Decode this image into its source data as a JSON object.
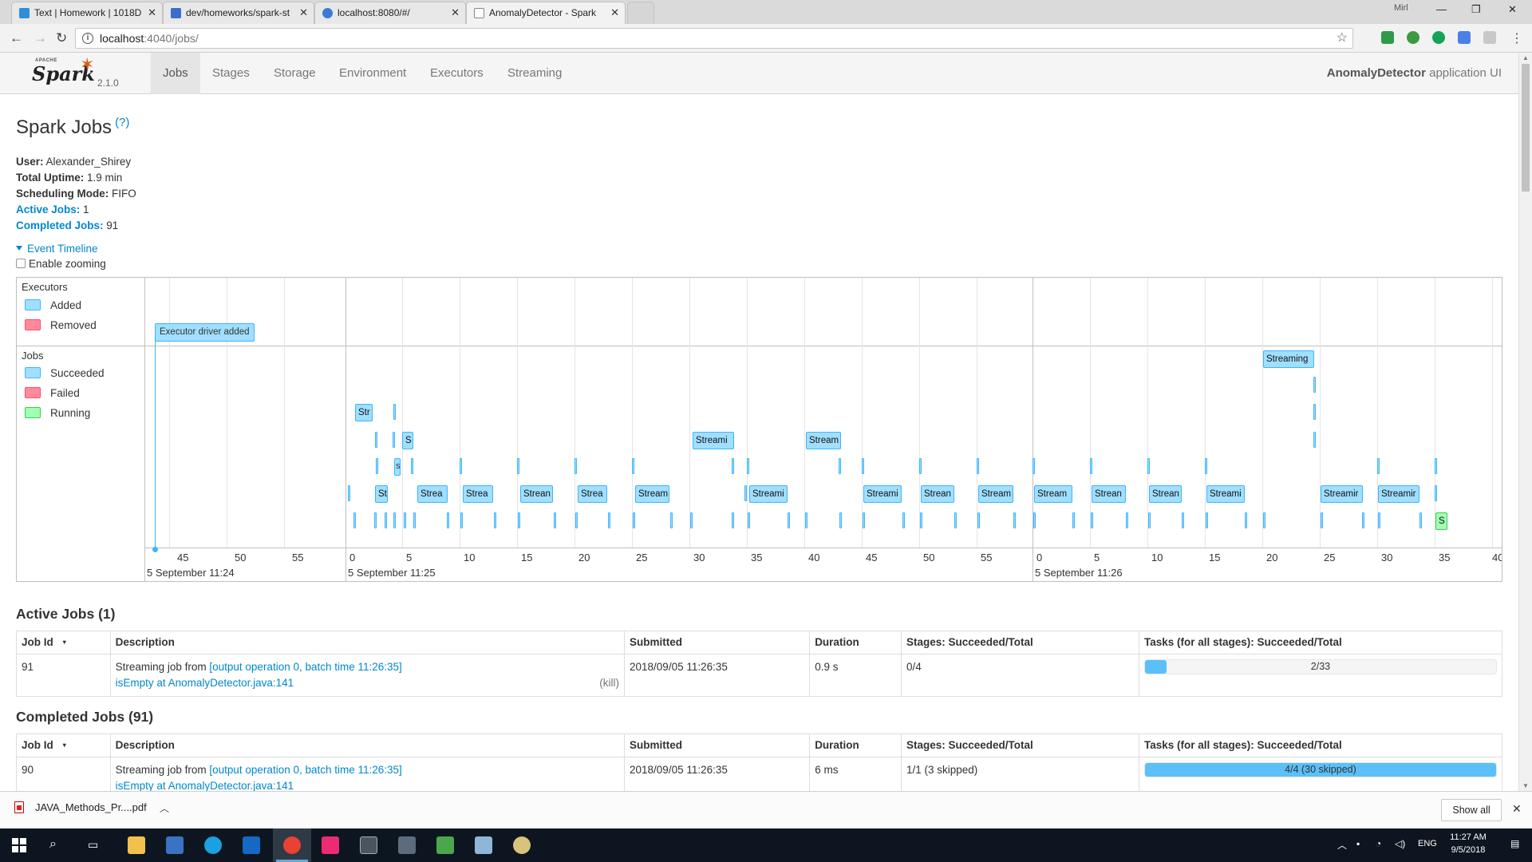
{
  "browser": {
    "tabs": [
      {
        "title": "Text | Homework | 1018D",
        "favicon_color": "#2d8fd5"
      },
      {
        "title": "dev/homeworks/spark-st",
        "favicon_color": "#3a6fc9"
      },
      {
        "title": "localhost:8080/#/",
        "favicon_color": "#3b7bd4"
      },
      {
        "title": "AnomalyDetector - Spark",
        "favicon_color": "#ffffff"
      }
    ],
    "user_badge": "Mirl",
    "url_host": "localhost",
    "url_rest": ":4040/jobs/"
  },
  "spark_nav": {
    "brand_apache": "APACHE",
    "brand_name": "Spark",
    "version": "2.1.0",
    "links": [
      "Jobs",
      "Stages",
      "Storage",
      "Environment",
      "Executors",
      "Streaming"
    ],
    "active_link": "Jobs",
    "app_name": "AnomalyDetector",
    "app_suffix": " application UI"
  },
  "page": {
    "title": "Spark Jobs",
    "help": "(?)"
  },
  "summary": {
    "user_label": "User:",
    "user_value": " Alexander_Shirey",
    "uptime_label": "Total Uptime:",
    "uptime_value": " 1.9 min",
    "mode_label": "Scheduling Mode:",
    "mode_value": " FIFO",
    "active_label": "Active Jobs:",
    "active_value": " 1",
    "completed_label": "Completed Jobs:",
    "completed_value": " 91"
  },
  "timeline": {
    "toggle_label": "Event Timeline",
    "zoom_label": "Enable zooming",
    "executors_group": "Executors",
    "jobs_group": "Jobs",
    "legend_executors": [
      "Added",
      "Removed"
    ],
    "legend_jobs": [
      "Succeeded",
      "Failed",
      "Running"
    ],
    "executor_event": "Executor driver added",
    "tick_labels": [
      "45",
      "50",
      "55",
      "0",
      "5",
      "10",
      "15",
      "20",
      "25",
      "30",
      "35",
      "40",
      "45",
      "50",
      "55",
      "0",
      "5",
      "10",
      "15",
      "20",
      "25",
      "30",
      "35",
      "40"
    ],
    "day_labels": [
      "5 September 11:24",
      "5 September 11:25",
      "5 September 11:26"
    ],
    "job_labels": [
      "Str",
      "S",
      "S",
      "Strea",
      "Strea",
      "Strean",
      "Strea",
      "Stream",
      "Streami",
      "Stream",
      "Streami",
      "Streami",
      "Strean",
      "Stream",
      "Stream",
      "Strean",
      "Strean",
      "Streami",
      "Streaming",
      "Streamir",
      "Streamir",
      "S",
      "St"
    ]
  },
  "active_jobs": {
    "title": "Active Jobs (1)",
    "headers": [
      "Job Id",
      "Description",
      "Submitted",
      "Duration",
      "Stages: Succeeded/Total",
      "Tasks (for all stages): Succeeded/Total"
    ],
    "sort_marker": "▾",
    "rows": [
      {
        "id": "91",
        "desc_prefix": "Streaming job from ",
        "desc_link": "[output operation 0, batch time 11:26:35]",
        "desc_line2": "isEmpty at AnomalyDetector.java:141",
        "kill": "(kill)",
        "submitted": "2018/09/05 11:26:35",
        "duration": "0.9 s",
        "stages": "0/4",
        "tasks_text": "2/33",
        "tasks_fraction": 0.0606
      }
    ]
  },
  "completed_jobs": {
    "title": "Completed Jobs (91)",
    "headers": [
      "Job Id",
      "Description",
      "Submitted",
      "Duration",
      "Stages: Succeeded/Total",
      "Tasks (for all stages): Succeeded/Total"
    ],
    "sort_marker": "▾",
    "rows": [
      {
        "id": "90",
        "desc_prefix": "Streaming job from ",
        "desc_link": "[output operation 0, batch time 11:26:35]",
        "desc_line2": "isEmpty at AnomalyDetector.java:141",
        "submitted": "2018/09/05 11:26:35",
        "duration": "6 ms",
        "stages": "1/1 (3 skipped)",
        "tasks_text": "4/4 (30 skipped)",
        "tasks_fraction": 1.0
      }
    ]
  },
  "download_bar": {
    "file": "JAVA_Methods_Pr....pdf",
    "show_all": "Show all"
  },
  "taskbar": {
    "time": "11:27 AM",
    "date": "9/5/2018",
    "lang": "ENG"
  },
  "colors": {
    "link": "#0088cc",
    "job_box": "#a0dfff",
    "job_border": "#3eb4ff",
    "running": "#a0ffb0",
    "progress": "#5bc0f8"
  }
}
